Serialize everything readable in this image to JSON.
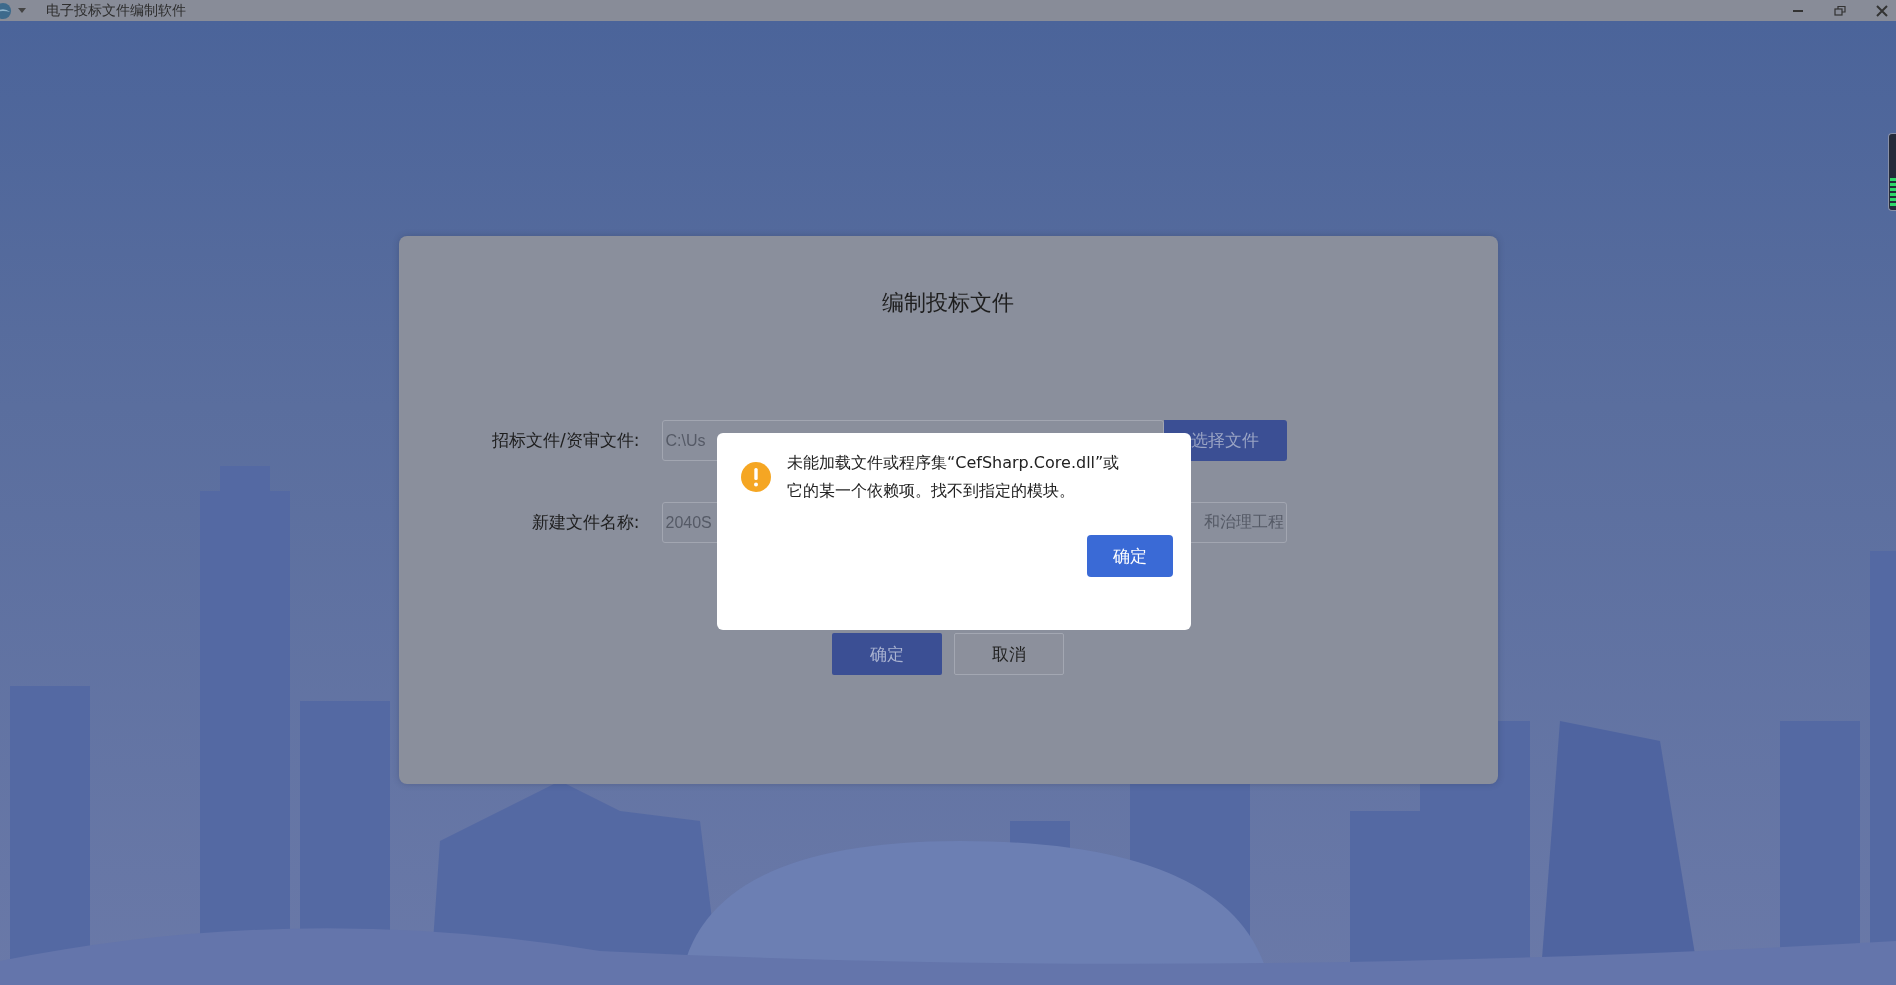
{
  "window": {
    "title": "电子投标文件编制软件"
  },
  "form": {
    "title": "编制投标文件",
    "fields": [
      {
        "label": "招标文件/资审文件:",
        "value_start": "C:\\Us",
        "button": "选择文件"
      },
      {
        "label": "新建文件名称:",
        "value_start": "2040S",
        "value_end": "和治理工程"
      }
    ],
    "buttons": [
      {
        "label": "确定",
        "kind": "primary"
      },
      {
        "label": "取消",
        "kind": "secondary"
      }
    ]
  },
  "dialog": {
    "message": "未能加载文件或程序集“CefSharp.Core.dll”或它的某一个依赖项。找不到指定的模块。",
    "button": "确定"
  }
}
